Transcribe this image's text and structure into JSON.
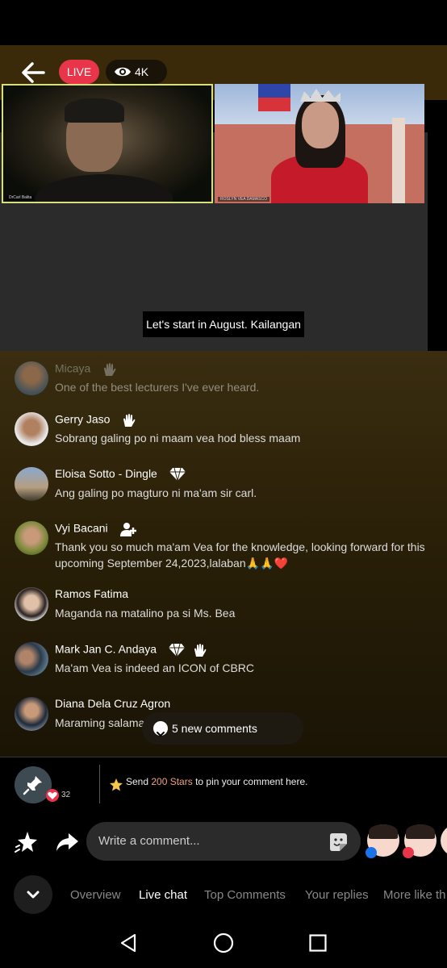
{
  "header": {
    "live_label": "LIVE",
    "viewer_count": "4K"
  },
  "video": {
    "caption": "Let's start in August. Kailangan",
    "left_name": "DrCarl Balita",
    "right_name": "ROSLYN VEA DAMASCO"
  },
  "comments": [
    {
      "name": "Micaya",
      "text": "One of the best lecturers I've ever heard.",
      "badges": [
        "wave-icon"
      ]
    },
    {
      "name": "Gerry Jaso",
      "text": "Sobrang galing po ni maam vea hod bless maam",
      "badges": [
        "wave-icon"
      ]
    },
    {
      "name": "Eloisa Sotto - Dingle",
      "text": "Ang galing po magturo ni ma'am sir carl.",
      "badges": [
        "diamond-icon"
      ]
    },
    {
      "name": "Vyi Bacani",
      "text": "Thank you so much ma'am Vea for the knowledge, looking forward for this upcoming September 24,2023,lalaban🙏🙏❤️",
      "badges": [
        "person-add-icon"
      ]
    },
    {
      "name": "Ramos Fatima",
      "text": "Maganda na matalino pa si  Ms. Bea",
      "badges": []
    },
    {
      "name": "Mark Jan C. Andaya",
      "text": "Ma'am Vea is indeed an ICON  of CBRC",
      "badges": [
        "diamond-icon",
        "wave-icon"
      ]
    },
    {
      "name": "Diana Dela Cruz Agron",
      "text": "Maraming salamat po Mis Vea❤️",
      "badges": []
    }
  ],
  "new_comments_label": "5 new comments",
  "pin": {
    "count": "32",
    "prefix": "Send ",
    "highlight": "200 Stars",
    "suffix": " to pin your comment here."
  },
  "compose": {
    "placeholder": "Write a comment..."
  },
  "tabs": [
    "Overview",
    "Live chat",
    "Top Comments",
    "Your replies",
    "More like th"
  ],
  "active_tab": "Live chat",
  "colors": {
    "live": "#e8354a",
    "pin_highlight": "#f3a27a"
  }
}
